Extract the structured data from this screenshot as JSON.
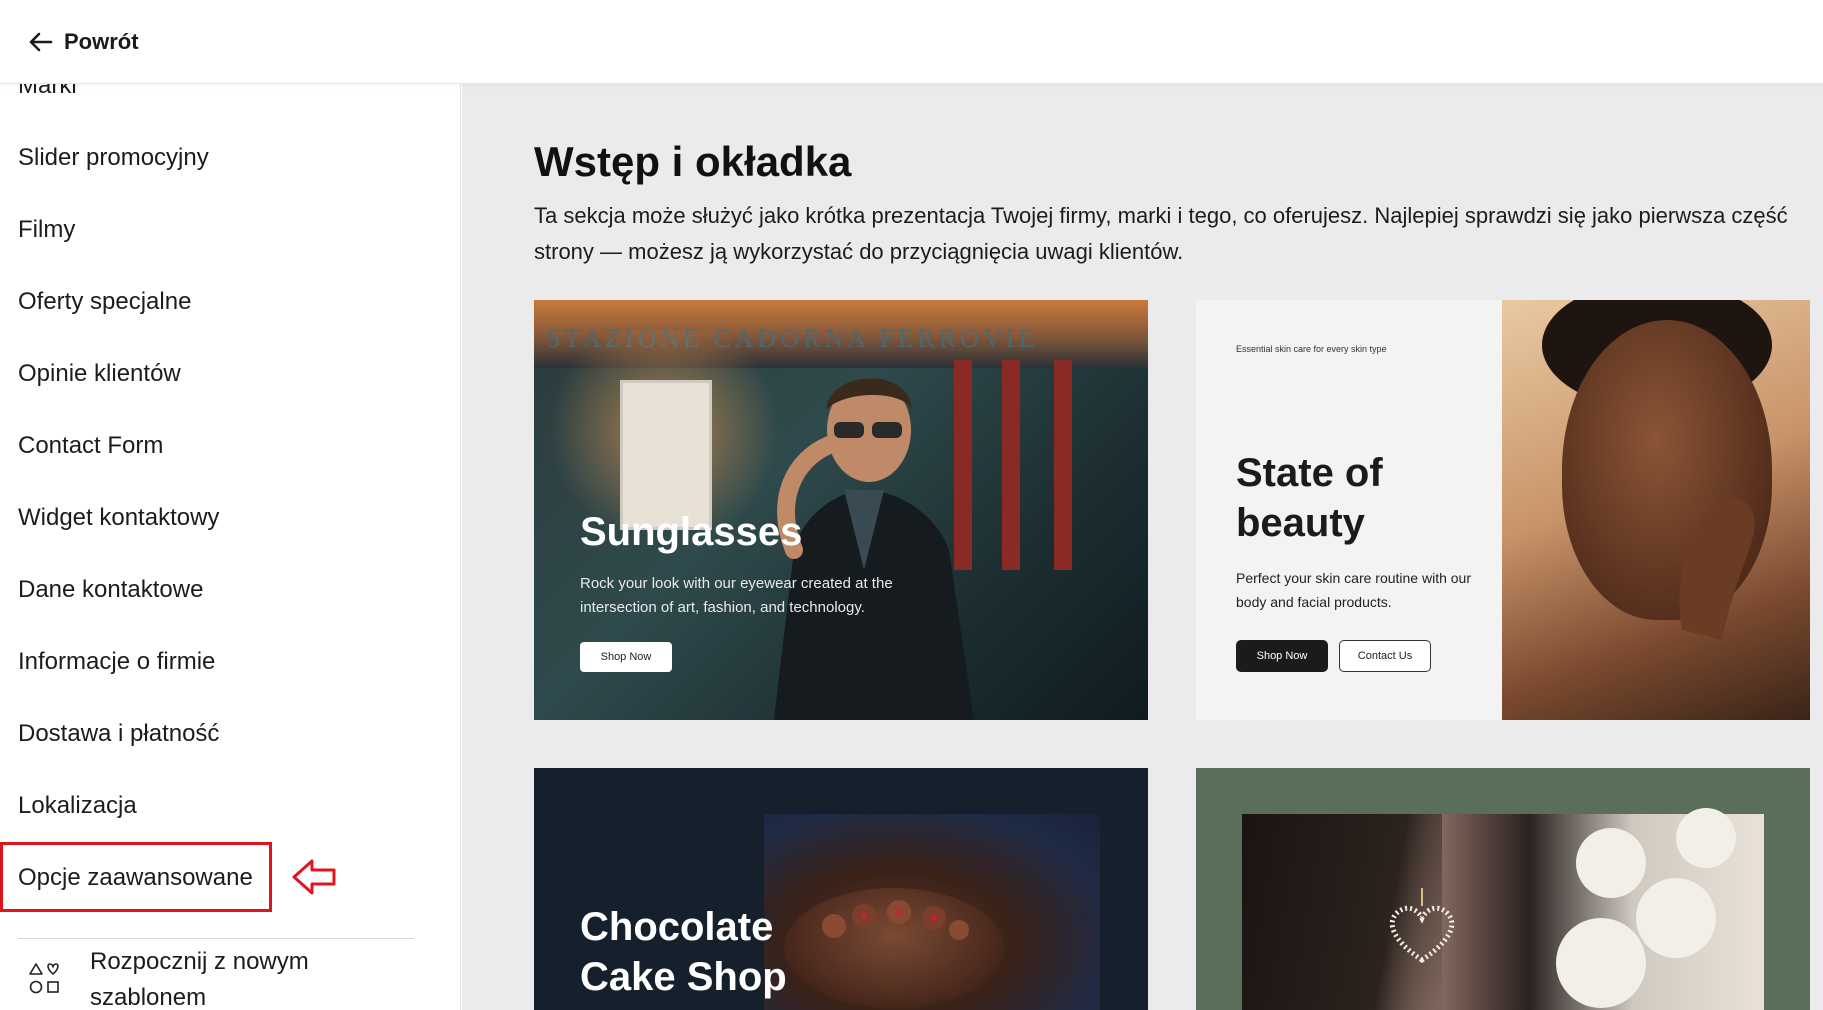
{
  "header": {
    "back_label": "Powrót"
  },
  "sidebar": {
    "cut_item": "Marki",
    "items": [
      {
        "label": "Slider promocyjny"
      },
      {
        "label": "Filmy"
      },
      {
        "label": "Oferty specjalne"
      },
      {
        "label": "Opinie klientów"
      },
      {
        "label": "Contact Form"
      },
      {
        "label": "Widget kontaktowy"
      },
      {
        "label": "Dane kontaktowe"
      },
      {
        "label": "Informacje o firmie"
      },
      {
        "label": "Dostawa i płatność"
      },
      {
        "label": "Lokalizacja"
      },
      {
        "label": "Opcje zaawansowane"
      }
    ],
    "template_label": "Rozpocznij z nowym szablonem"
  },
  "main": {
    "title": "Wstęp i okładka",
    "description": "Ta sekcja może służyć jako krótka prezentacja Twojej firmy, marki i tego, co oferujesz. Najlepiej sprawdzi się jako pierwsza część strony — możesz ją wykorzystać do przyciągnięcia uwagi klientów.",
    "cards": [
      {
        "sign": "STAZIONE CADORNA FERROVIE",
        "title": "Sunglasses",
        "subtitle": "Rock your look with our eyewear created at the intersection of art, fashion, and technology.",
        "button": "Shop Now"
      },
      {
        "tag": "Essential skin care for every skin type",
        "title": "State of beauty",
        "subtitle": "Perfect your skin care routine with our body and facial products.",
        "button_primary": "Shop Now",
        "button_secondary": "Contact Us"
      },
      {
        "title": "Chocolate Cake Shop"
      },
      {
        "title": ""
      }
    ]
  },
  "colors": {
    "highlight": "#e0141f",
    "main_bg": "#ebebee"
  }
}
